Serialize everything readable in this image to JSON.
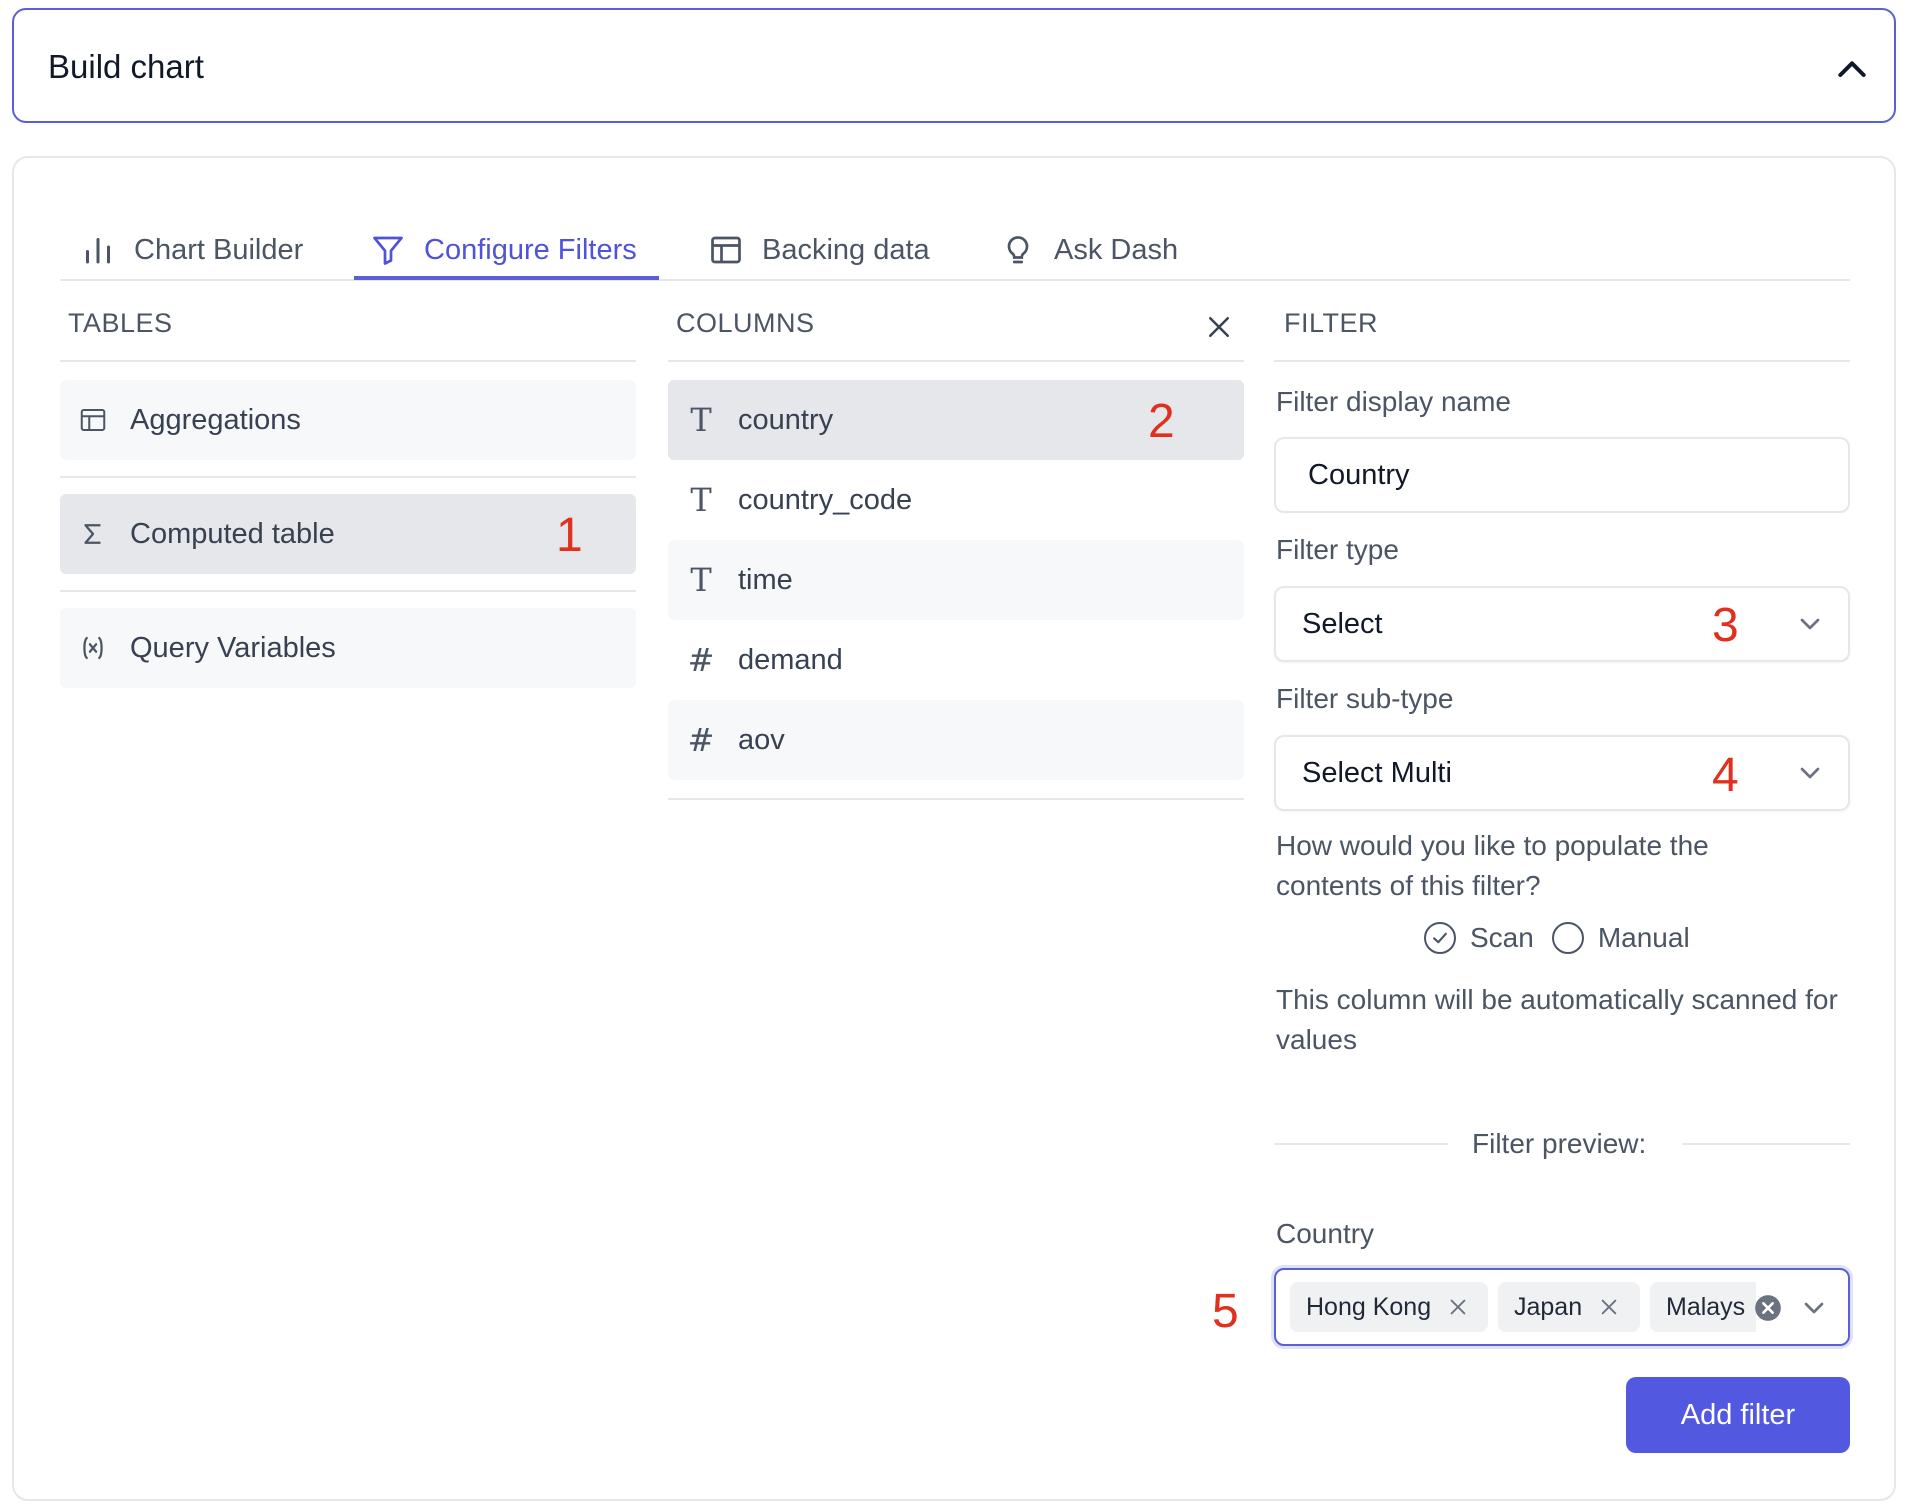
{
  "header": {
    "title": "Build chart",
    "collapse_icon": "chevron-up-icon"
  },
  "tabs": [
    {
      "label": "Chart Builder",
      "icon": "bar-chart-icon",
      "active": false
    },
    {
      "label": "Configure Filters",
      "icon": "filter-icon",
      "active": true
    },
    {
      "label": "Backing data",
      "icon": "table-icon",
      "active": false
    },
    {
      "label": "Ask Dash",
      "icon": "lightbulb-icon",
      "active": false
    }
  ],
  "tables": {
    "heading": "TABLES",
    "items": [
      {
        "label": "Aggregations",
        "icon": "table-icon"
      },
      {
        "label": "Computed table",
        "icon": "sigma-icon",
        "badge": "1"
      },
      {
        "label": "Query Variables",
        "icon": "variable-icon"
      }
    ]
  },
  "columns": {
    "heading": "COLUMNS",
    "close_icon": "close-icon",
    "items": [
      {
        "label": "country",
        "type_glyph": "T",
        "badge": "2"
      },
      {
        "label": "country_code",
        "type_glyph": "T"
      },
      {
        "label": "time",
        "type_glyph": "T"
      },
      {
        "label": "demand",
        "type_glyph": "#"
      },
      {
        "label": "aov",
        "type_glyph": "#"
      }
    ]
  },
  "filter": {
    "heading": "FILTER",
    "display_name_label": "Filter display name",
    "display_name_value": "Country",
    "type_label": "Filter type",
    "type_value": "Select",
    "type_badge": "3",
    "subtype_label": "Filter sub-type",
    "subtype_value": "Select Multi",
    "subtype_badge": "4",
    "populate_question": "How would you like to populate the contents of this filter?",
    "populate_options": {
      "scan": "Scan",
      "manual": "Manual"
    },
    "populate_selected": "Scan",
    "scan_note": "This column will be automatically scanned for values",
    "preview_heading": "Filter preview:",
    "preview_label": "Country",
    "preview_badge": "5",
    "preview_chips": [
      "Hong Kong",
      "Japan",
      "Malays"
    ],
    "add_button": "Add filter"
  }
}
